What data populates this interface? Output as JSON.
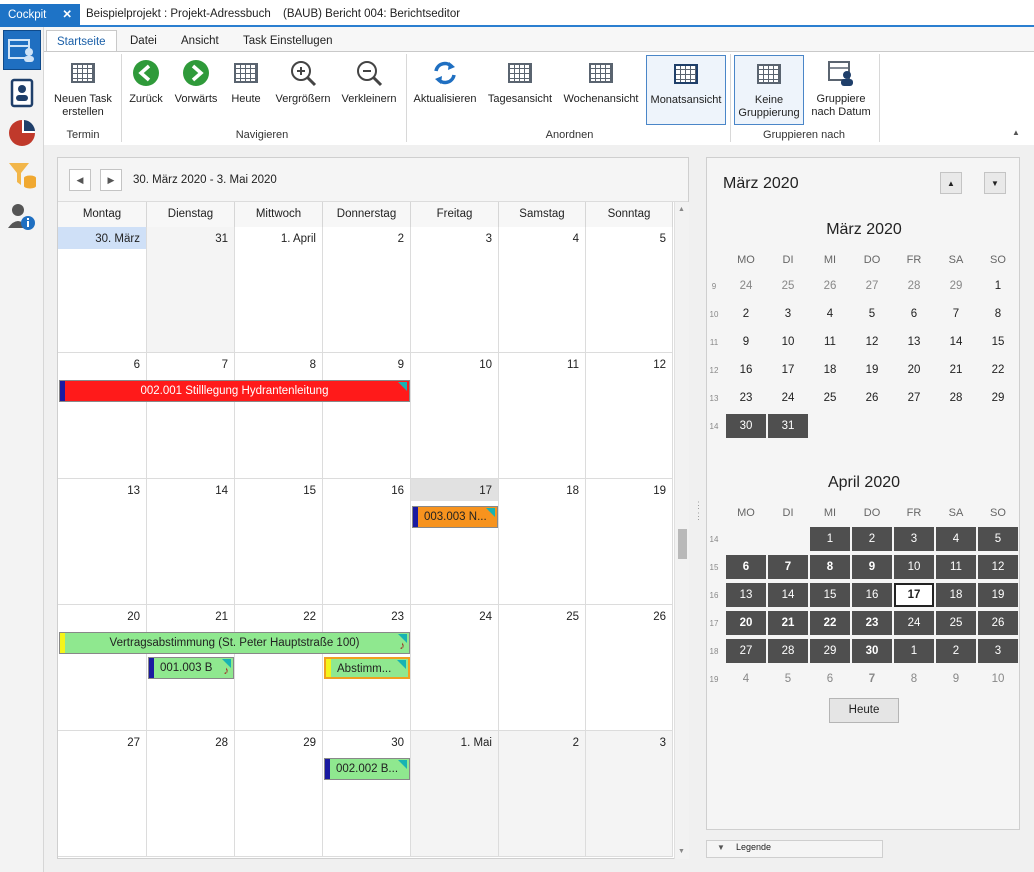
{
  "tabs": [
    {
      "label": "Cockpit",
      "active": true
    },
    {
      "label": "Beispielprojekt : Projekt-Adressbuch"
    },
    {
      "label": "(BAUB) Bericht 004: Berichtseditor"
    }
  ],
  "ribbon": {
    "tabs": [
      "Startseite",
      "Datei",
      "Ansicht",
      "Task Einstellugen"
    ],
    "buttons": {
      "new_task": "Neuen Task erstellen",
      "back": "Zurück",
      "forward": "Vorwärts",
      "today": "Heute",
      "zoom_in": "Vergrößern",
      "zoom_out": "Verkleinern",
      "refresh": "Aktualisieren",
      "day_view": "Tagesansicht",
      "week_view": "Wochenansicht",
      "month_view": "Monatsansicht",
      "no_group": "Keine Gruppierung",
      "group_date": "Gruppiere nach Datum"
    },
    "groups": {
      "termin": "Termin",
      "navigieren": "Navigieren",
      "anordnen": "Anordnen",
      "gruppieren": "Gruppieren nach"
    }
  },
  "calendar": {
    "range": "30. März 2020 - 3. Mai 2020",
    "weekdays": [
      "Montag",
      "Dienstag",
      "Mittwoch",
      "Donnerstag",
      "Freitag",
      "Samstag",
      "Sonntag"
    ],
    "weeks": [
      [
        "30. März",
        "31",
        "1. April",
        "2",
        "3",
        "4",
        "5"
      ],
      [
        "6",
        "7",
        "8",
        "9",
        "10",
        "11",
        "12"
      ],
      [
        "13",
        "14",
        "15",
        "16",
        "17",
        "18",
        "19"
      ],
      [
        "20",
        "21",
        "22",
        "23",
        "24",
        "25",
        "26"
      ],
      [
        "27",
        "28",
        "29",
        "30",
        "1. Mai",
        "2",
        "3"
      ]
    ],
    "events": {
      "e1": {
        "text": "002.001 Stilllegung Hydrantenleitung",
        "bg": "#ff1a1a",
        "bar": "#1a1aa0"
      },
      "e2": {
        "text": "003.003 N...",
        "bg": "#f7931e",
        "bar": "#1a1aa0"
      },
      "e3": {
        "text": "Vertragsabstimmung (St. Peter Hauptstraße 100)",
        "bg": "#8fe88f",
        "bar": "#f4f41a"
      },
      "e4": {
        "text": "001.003 B",
        "bg": "#8fe88f",
        "bar": "#1a1aa0"
      },
      "e5": {
        "text": "Abstimm...",
        "bg": "#8fe88f",
        "bar": "#f4f41a"
      },
      "e6": {
        "text": "002.002 B...",
        "bg": "#8fe88f",
        "bar": "#1a1aa0"
      }
    }
  },
  "navigator": {
    "title": "März 2020",
    "today_button": "Heute",
    "legend": "Legende",
    "weekday_abbr": [
      "MO",
      "DI",
      "MI",
      "DO",
      "FR",
      "SA",
      "SO"
    ],
    "months": [
      {
        "name": "März 2020",
        "weeks": [
          "9",
          "10",
          "11",
          "12",
          "13",
          "14"
        ],
        "rows": [
          [
            "24",
            "25",
            "26",
            "27",
            "28",
            "29",
            "1"
          ],
          [
            "2",
            "3",
            "4",
            "5",
            "6",
            "7",
            "8"
          ],
          [
            "9",
            "10",
            "11",
            "12",
            "13",
            "14",
            "15"
          ],
          [
            "16",
            "17",
            "18",
            "19",
            "20",
            "21",
            "22"
          ],
          [
            "23",
            "24",
            "25",
            "26",
            "27",
            "28",
            "29"
          ],
          [
            "30",
            "31",
            "",
            "",
            "",
            "",
            ""
          ]
        ]
      },
      {
        "name": "April 2020",
        "weeks": [
          "14",
          "15",
          "16",
          "17",
          "18",
          "19"
        ],
        "rows": [
          [
            "",
            "",
            "1",
            "2",
            "3",
            "4",
            "5"
          ],
          [
            "6",
            "7",
            "8",
            "9",
            "10",
            "11",
            "12"
          ],
          [
            "13",
            "14",
            "15",
            "16",
            "17",
            "18",
            "19"
          ],
          [
            "20",
            "21",
            "22",
            "23",
            "24",
            "25",
            "26"
          ],
          [
            "27",
            "28",
            "29",
            "30",
            "1",
            "2",
            "3"
          ],
          [
            "4",
            "5",
            "6",
            "7",
            "8",
            "9",
            "10"
          ]
        ]
      }
    ]
  }
}
